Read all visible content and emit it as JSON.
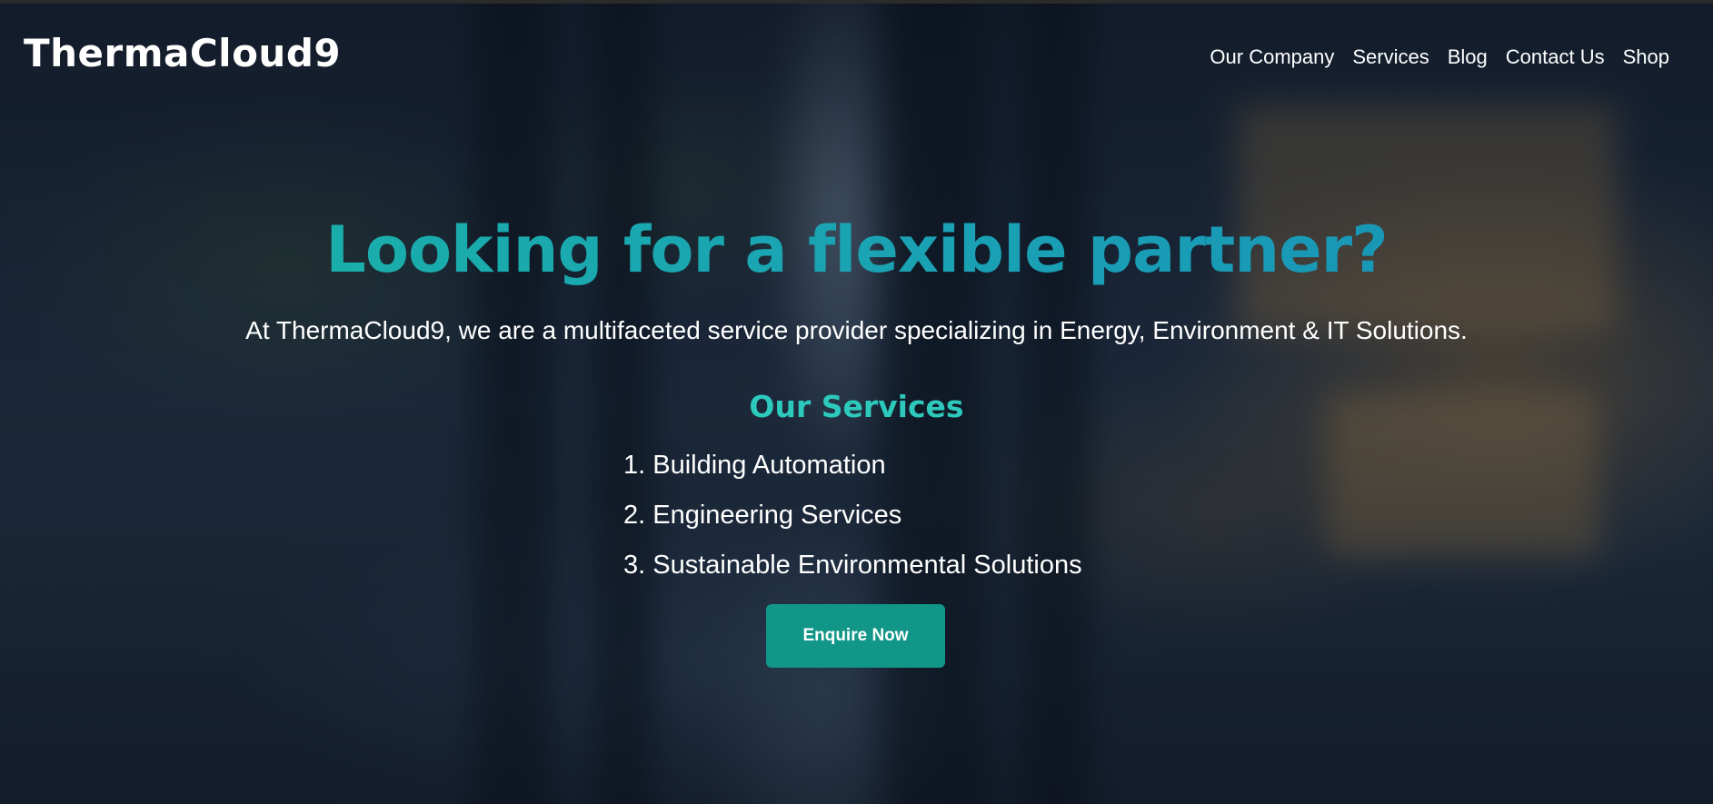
{
  "brand": {
    "name": "ThermaCloud9"
  },
  "nav": {
    "items": [
      {
        "label": "Our Company"
      },
      {
        "label": "Services"
      },
      {
        "label": "Blog"
      },
      {
        "label": "Contact Us"
      },
      {
        "label": "Shop"
      }
    ]
  },
  "hero": {
    "headline": "Looking for a flexible partner?",
    "subheadline": "At ThermaCloud9, we are a multifaceted service provider specializing in Energy, Environment & IT Solutions.",
    "services_title": "Our Services",
    "services": [
      "1. Building Automation",
      "2. Engineering Services",
      "3. Sustainable Environmental Solutions"
    ],
    "cta_label": "Enquire Now"
  },
  "colors": {
    "headline": "#17a2b8",
    "services_title": "#2ec9bd",
    "cta_background": "#119688",
    "text": "#ffffff"
  }
}
